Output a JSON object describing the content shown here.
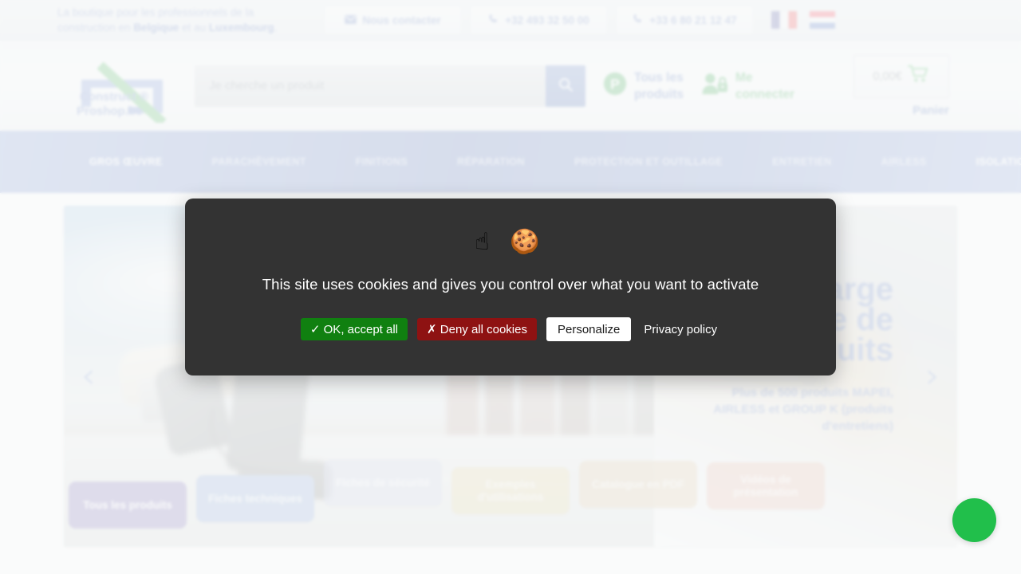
{
  "topbar": {
    "tagline_line1": "La boutique pour les professionnels de la",
    "tagline_line2_pre": "construction en ",
    "tagline_strong1": "Belgique",
    "tagline_mid": " et au ",
    "tagline_strong2": "Luxembourg",
    "tagline_end": ".",
    "contact_buttons": [
      {
        "icon": "envelope-icon",
        "label": "Nous contacter"
      },
      {
        "icon": "phone-icon",
        "label": "+32 493 32 50 00"
      },
      {
        "icon": "phone-icon",
        "label": "+33 6 80 21 12 47"
      }
    ],
    "flags": [
      {
        "name": "flag-fr",
        "title": "Français"
      },
      {
        "name": "flag-nl",
        "title": "Nederlands"
      }
    ]
  },
  "header": {
    "logo": {
      "line1": "Construct ®",
      "line2": "Proshop.be"
    },
    "search": {
      "placeholder": "Je cherche un produit",
      "value": "",
      "button_icon": "search-icon"
    },
    "products_link": {
      "icon": "products-p-icon",
      "label": "Tous les produits"
    },
    "login_link": {
      "icon": "user-lock-icon",
      "label": "Me connecter"
    },
    "cart": {
      "amount": "0,00€",
      "icon": "cart-icon",
      "label": "Panier"
    }
  },
  "nav": {
    "items": [
      {
        "label": "GROS ŒUVRE",
        "bright": true
      },
      {
        "label": "PARACHÈVEMENT",
        "bright": false
      },
      {
        "label": "FINITIONS",
        "bright": false
      },
      {
        "label": "RÉPARATION",
        "bright": false
      },
      {
        "label": "PROTECTION ET OUTILLAGE",
        "bright": false
      },
      {
        "label": "ENTRETIEN",
        "bright": false
      },
      {
        "label": "AIRLESS",
        "bright": false
      },
      {
        "label": "ISOLATION",
        "bright": true
      }
    ]
  },
  "hero": {
    "title": "Large catalogue de produits",
    "subtitle": "Plus de 500 produits MAPEI, AIRLESS et GROUP K (produits d'entretiens)",
    "prev_arrow": "‹",
    "next_arrow": "›"
  },
  "tiles": [
    {
      "label": "Tous les produits",
      "color": "#9b90c6"
    },
    {
      "label": "Fiches techniques",
      "color": "#a8bce0"
    },
    {
      "label": "Fiches de sécurité",
      "color": "#c7cbe4"
    },
    {
      "label": "Exemples d'utilisations",
      "color": "#e2d096"
    },
    {
      "label": "Catalogue en PDF",
      "color": "#dfc8a4"
    },
    {
      "label": "Vidéos de présentation",
      "color": "#e8baa8"
    }
  ],
  "cookie_modal": {
    "emojis": "☝ 🍪",
    "message": "This site uses cookies and gives you control over what you want to activate",
    "accept_label": "✓ OK, accept all",
    "deny_label": "✗ Deny all cookies",
    "personalize_label": "Personalize",
    "privacy_label": "Privacy policy",
    "background_color": "#333333",
    "accept_color": "#108010",
    "deny_color": "#8e1212"
  },
  "chat": {
    "icon": "whatsapp-chat-icon",
    "color": "#21bf4b"
  }
}
